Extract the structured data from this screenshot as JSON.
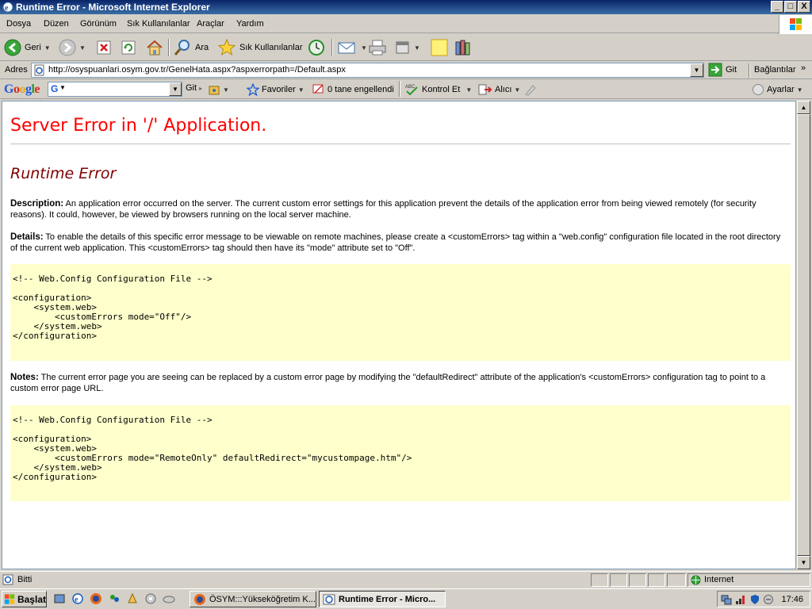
{
  "window": {
    "title": "Runtime Error - Microsoft Internet Explorer",
    "min_label": "_",
    "max_label": "□",
    "close_label": "X"
  },
  "menu": {
    "items": [
      "Dosya",
      "Düzen",
      "Görünüm",
      "Sık Kullanılanlar",
      "Araçlar",
      "Yardım"
    ]
  },
  "toolbar": {
    "back_label": "Geri",
    "search_label": "Ara",
    "favorites_label": "Sık Kullanılanlar"
  },
  "address": {
    "label": "Adres",
    "url": "http://osyspuanlari.osym.gov.tr/GenelHata.aspx?aspxerrorpath=/Default.aspx",
    "go_label": "Git",
    "links_label": "Bağlantılar"
  },
  "google_bar": {
    "logo": "Google",
    "search_placeholder": "G",
    "go_label": "Git",
    "favorites_label": "Favoriler",
    "blocked_label": "0 tane engellendi",
    "spellcheck_label": "Kontrol Et",
    "send_label": "Alıcı",
    "settings_label": "Ayarlar"
  },
  "page": {
    "heading": "Server Error in '/' Application.",
    "subheading": "Runtime Error",
    "description_label": "Description:",
    "description_text": "An application error occurred on the server. The current custom error settings for this application prevent the details of the application error from being viewed remotely (for security reasons). It could, however, be viewed by browsers running on the local server machine.",
    "details_label": "Details:",
    "details_text": "To enable the details of this specific error message to be viewable on remote machines, please create a <customErrors> tag within a \"web.config\" configuration file located in the root directory of the current web application. This <customErrors> tag should then have its \"mode\" attribute set to \"Off\".",
    "code1": "<!-- Web.Config Configuration File -->\n\n<configuration>\n    <system.web>\n        <customErrors mode=\"Off\"/>\n    </system.web>\n</configuration>",
    "notes_label": "Notes:",
    "notes_text": "The current error page you are seeing can be replaced by a custom error page by modifying the \"defaultRedirect\" attribute of the application's <customErrors> configuration tag to point to a custom error page URL.",
    "code2": "<!-- Web.Config Configuration File -->\n\n<configuration>\n    <system.web>\n        <customErrors mode=\"RemoteOnly\" defaultRedirect=\"mycustompage.htm\"/>\n    </system.web>\n</configuration>"
  },
  "status": {
    "text": "Bitti",
    "zone": "Internet"
  },
  "taskbar": {
    "start_label": "Başlat",
    "tasks": [
      "ÖSYM:::Yükseköğretim K...",
      "Runtime Error - Micro..."
    ],
    "clock": "17:46"
  },
  "colors": {
    "heading": "#ff0000",
    "subheading": "#800000",
    "code_bg": "#ffffcc",
    "titlebar": "#0a246a"
  }
}
